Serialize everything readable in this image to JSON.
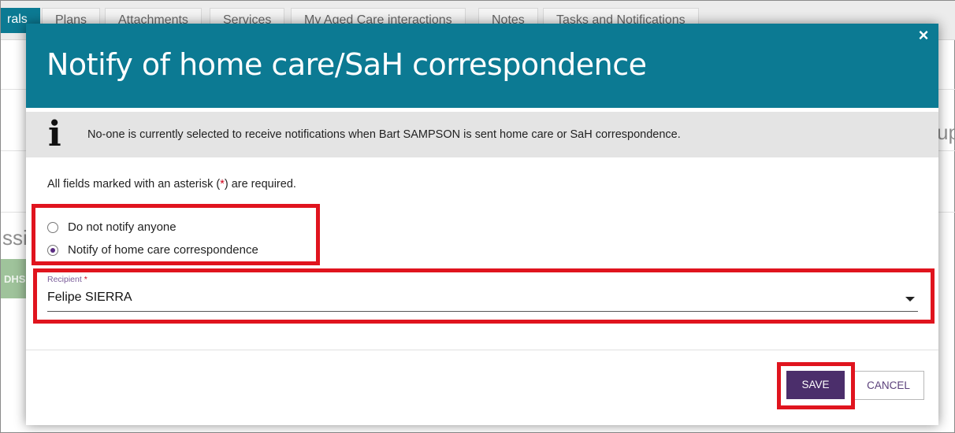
{
  "background": {
    "tabs": [
      {
        "label": "rals"
      },
      {
        "label": "Plans"
      },
      {
        "label": "Attachments"
      },
      {
        "label": "Services"
      },
      {
        "label": "My Aged Care interactions"
      },
      {
        "label": "Notes"
      },
      {
        "label": "Tasks and Notifications"
      }
    ],
    "fragments": {
      "left_text": "ssi",
      "right_text": "up",
      "green_badge": "DHS"
    }
  },
  "modal": {
    "title": "Notify of home care/SaH correspondence",
    "close_symbol": "×",
    "info": {
      "icon": "i",
      "text": "No-one is currently selected to receive notifications when Bart SAMPSON is sent home care or SaH correspondence."
    },
    "required_note": {
      "prefix": "All fields marked with an asterisk (",
      "asterisk": "*",
      "suffix": ") are required."
    },
    "options": [
      {
        "label": "Do not notify anyone",
        "checked": false
      },
      {
        "label": "Notify of home care correspondence",
        "checked": true
      }
    ],
    "recipient": {
      "label": "Recipient",
      "asterisk": "*",
      "value": "Felipe SIERRA"
    },
    "buttons": {
      "save": "SAVE",
      "cancel": "CANCEL"
    }
  },
  "colors": {
    "header": "#0c7a93",
    "primary_button": "#4b2e6b",
    "annotation": "#e0141e"
  }
}
